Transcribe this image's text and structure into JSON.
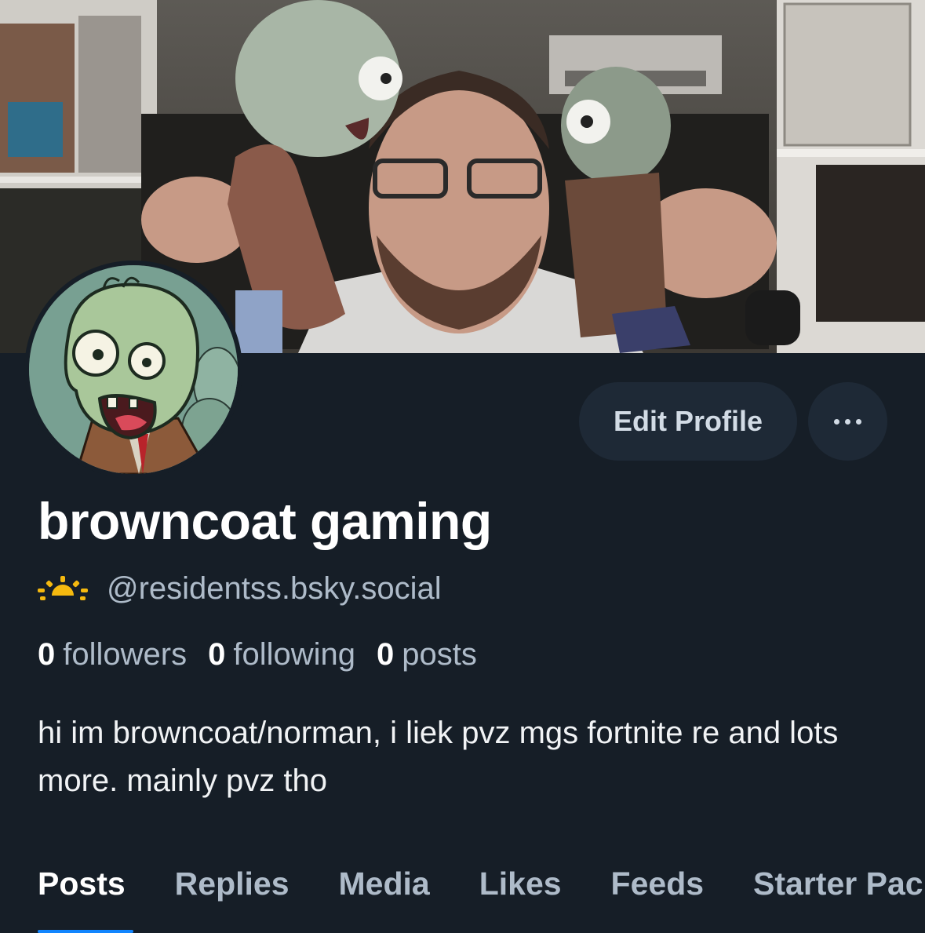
{
  "profile": {
    "display_name": "browncoat gaming",
    "handle": "@residentss.bsky.social",
    "handle_icon": "sunrise-icon",
    "followers_count": "0",
    "followers_label": "followers",
    "following_count": "0",
    "following_label": "following",
    "posts_count": "0",
    "posts_label": "posts",
    "bio": "hi im browncoat/norman, i liek pvz mgs fortnite re and lots more. mainly pvz tho"
  },
  "actions": {
    "edit_profile_label": "Edit Profile",
    "more_icon": "ellipsis-icon"
  },
  "tabs": [
    {
      "label": "Posts",
      "active": true
    },
    {
      "label": "Replies"
    },
    {
      "label": "Media"
    },
    {
      "label": "Likes"
    },
    {
      "label": "Feeds"
    },
    {
      "label": "Starter Packs"
    }
  ],
  "colors": {
    "background": "#161e27",
    "button_bg": "#1e2936",
    "accent": "#1185fe",
    "muted_text": "#aebbc9",
    "sun_icon": "#f5b90f"
  }
}
